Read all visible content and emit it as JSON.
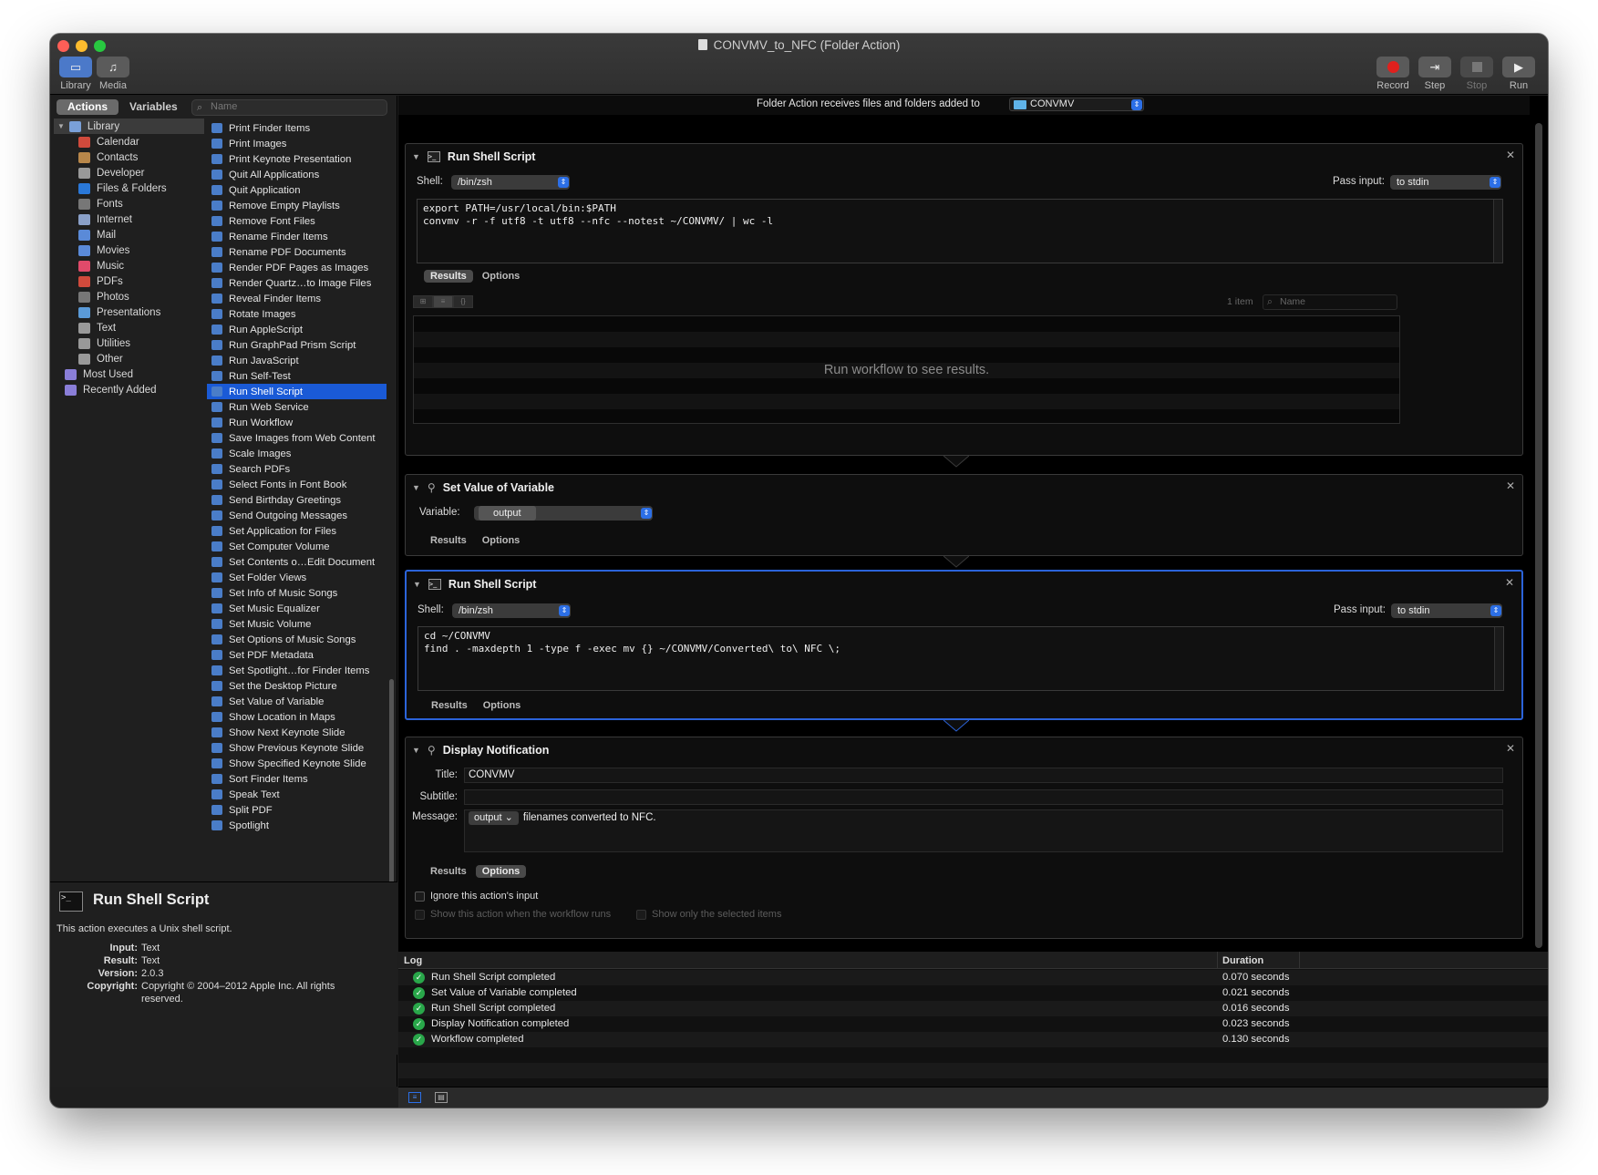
{
  "window": {
    "title": "CONVMV_to_NFC (Folder Action)"
  },
  "toolbar": {
    "library": "Library",
    "media": "Media",
    "record": "Record",
    "step": "Step",
    "stop": "Stop",
    "run": "Run"
  },
  "sidebar": {
    "tab_actions": "Actions",
    "tab_variables": "Variables",
    "search_placeholder": "Name",
    "library_root": "Library",
    "categories": [
      "Calendar",
      "Contacts",
      "Developer",
      "Files & Folders",
      "Fonts",
      "Internet",
      "Mail",
      "Movies",
      "Music",
      "PDFs",
      "Photos",
      "Presentations",
      "Text",
      "Utilities",
      "Other"
    ],
    "smart_groups": [
      "Most Used",
      "Recently Added"
    ]
  },
  "actions_list": [
    "Print Finder Items",
    "Print Images",
    "Print Keynote Presentation",
    "Quit All Applications",
    "Quit Application",
    "Remove Empty Playlists",
    "Remove Font Files",
    "Rename Finder Items",
    "Rename PDF Documents",
    "Render PDF Pages as Images",
    "Render Quartz…to Image Files",
    "Reveal Finder Items",
    "Rotate Images",
    "Run AppleScript",
    "Run GraphPad Prism Script",
    "Run JavaScript",
    "Run Self-Test",
    "Run Shell Script",
    "Run Web Service",
    "Run Workflow",
    "Save Images from Web Content",
    "Scale Images",
    "Search PDFs",
    "Select Fonts in Font Book",
    "Send Birthday Greetings",
    "Send Outgoing Messages",
    "Set Application for Files",
    "Set Computer Volume",
    "Set Contents o…Edit Document",
    "Set Folder Views",
    "Set Info of Music Songs",
    "Set Music Equalizer",
    "Set Music Volume",
    "Set Options of Music Songs",
    "Set PDF Metadata",
    "Set Spotlight…for Finder Items",
    "Set the Desktop Picture",
    "Set Value of Variable",
    "Show Location in Maps",
    "Show Next Keynote Slide",
    "Show Previous Keynote Slide",
    "Show Specified Keynote Slide",
    "Sort Finder Items",
    "Speak Text",
    "Split PDF",
    "Spotlight"
  ],
  "selected_action": "Run Shell Script",
  "description": {
    "title": "Run Shell Script",
    "text": "This action executes a Unix shell script.",
    "input_label": "Input:",
    "input": "Text",
    "result_label": "Result:",
    "result": "Text",
    "version_label": "Version:",
    "version": "2.0.3",
    "copyright_label": "Copyright:",
    "copyright_1": "Copyright © 2004–2012 Apple Inc.  All rights",
    "copyright_2": "reserved."
  },
  "folder_action": {
    "label": "Folder Action receives files and folders added to",
    "folder": "CONVMV"
  },
  "workflow": {
    "a1": {
      "title": "Run Shell Script",
      "shell_label": "Shell:",
      "shell": "/bin/zsh",
      "pass_label": "Pass input:",
      "pass": "to stdin",
      "code": "export PATH=/usr/local/bin:$PATH\nconvmv -r -f utf8 -t utf8 --nfc --notest ~/CONVMV/ | wc -l",
      "tab_results": "Results",
      "tab_options": "Options",
      "item_count": "1 item",
      "search_placeholder": "Name",
      "empty_results": "Run workflow to see results."
    },
    "a2": {
      "title": "Set Value of Variable",
      "variable_label": "Variable:",
      "variable": "output",
      "tab_results": "Results",
      "tab_options": "Options"
    },
    "a3": {
      "title": "Run Shell Script",
      "shell_label": "Shell:",
      "shell": "/bin/zsh",
      "pass_label": "Pass input:",
      "pass": "to stdin",
      "code": "cd ~/CONVMV\nfind . -maxdepth 1 -type f -exec mv {} ~/CONVMV/Converted\\ to\\ NFC \\;",
      "tab_results": "Results",
      "tab_options": "Options"
    },
    "a4": {
      "title": "Display Notification",
      "title_label": "Title:",
      "title_value": "CONVMV",
      "subtitle_label": "Subtitle:",
      "subtitle_value": "",
      "message_label": "Message:",
      "message_token": "output ⌄",
      "message_text": "filenames converted to NFC.",
      "tab_results": "Results",
      "tab_options": "Options",
      "opt_ignore": "Ignore this action's input",
      "opt_show": "Show this action when the workflow runs",
      "opt_selected": "Show only the selected items"
    }
  },
  "log": {
    "col_log": "Log",
    "col_duration": "Duration",
    "rows": [
      {
        "msg": "Run Shell Script completed",
        "dur": "0.070 seconds"
      },
      {
        "msg": "Set Value of Variable completed",
        "dur": "0.021 seconds"
      },
      {
        "msg": "Run Shell Script completed",
        "dur": "0.016 seconds"
      },
      {
        "msg": "Display Notification completed",
        "dur": "0.023 seconds"
      },
      {
        "msg": "Workflow completed",
        "dur": "0.130 seconds"
      }
    ]
  },
  "colors": {
    "accent": "#1a5ad6",
    "record": "#e0201d",
    "success": "#29a74a"
  }
}
